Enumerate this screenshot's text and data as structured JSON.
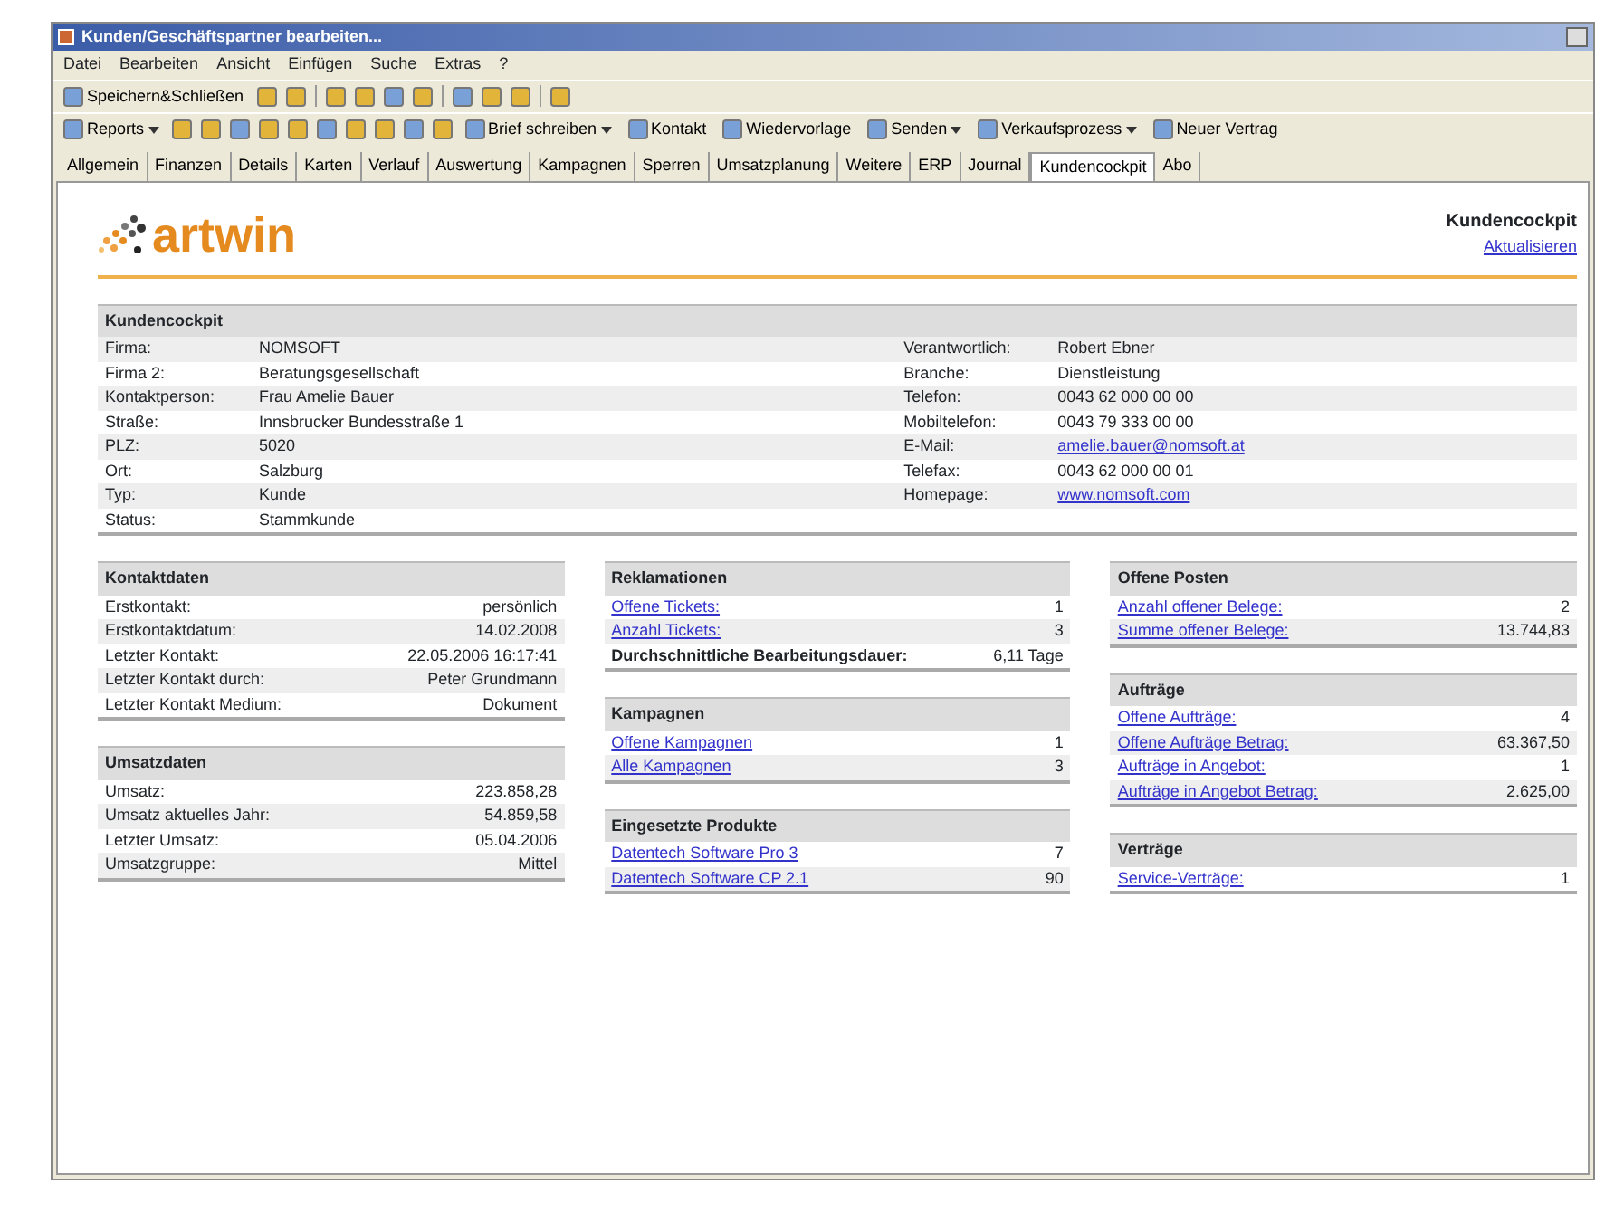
{
  "window": {
    "title": "Kunden/Geschäftspartner bearbeiten..."
  },
  "menu": [
    "Datei",
    "Bearbeiten",
    "Ansicht",
    "Einfügen",
    "Suche",
    "Extras",
    "?"
  ],
  "toolbar": [
    {
      "kind": "button",
      "label": "Speichern&Schließen"
    },
    {
      "kind": "icon"
    },
    {
      "kind": "icon"
    },
    {
      "kind": "sep"
    },
    {
      "kind": "icon"
    },
    {
      "kind": "icon"
    },
    {
      "kind": "icon"
    },
    {
      "kind": "icon"
    },
    {
      "kind": "sep"
    },
    {
      "kind": "icon"
    },
    {
      "kind": "icon"
    },
    {
      "kind": "icon"
    },
    {
      "kind": "sep"
    },
    {
      "kind": "icon"
    }
  ],
  "toolbar2": [
    {
      "kind": "dropdown",
      "label": "Reports"
    },
    {
      "kind": "icon"
    },
    {
      "kind": "icon"
    },
    {
      "kind": "icon"
    },
    {
      "kind": "icon"
    },
    {
      "kind": "icon"
    },
    {
      "kind": "icon"
    },
    {
      "kind": "icon"
    },
    {
      "kind": "icon"
    },
    {
      "kind": "icon"
    },
    {
      "kind": "icon"
    },
    {
      "kind": "dropdown",
      "label": "Brief schreiben"
    },
    {
      "kind": "button",
      "label": "Kontakt"
    },
    {
      "kind": "button",
      "label": "Wiedervorlage"
    },
    {
      "kind": "dropdown",
      "label": "Senden"
    },
    {
      "kind": "dropdown",
      "label": "Verkaufsprozess"
    },
    {
      "kind": "button",
      "label": "Neuer Vertrag"
    }
  ],
  "tabs": [
    {
      "label": "Allgemein",
      "selected": false
    },
    {
      "label": "Finanzen",
      "selected": false
    },
    {
      "label": "Details",
      "selected": false
    },
    {
      "label": "Karten",
      "selected": false
    },
    {
      "label": "Verlauf",
      "selected": false
    },
    {
      "label": "Auswertung",
      "selected": false
    },
    {
      "label": "Kampagnen",
      "selected": false
    },
    {
      "label": "Sperren",
      "selected": false
    },
    {
      "label": "Umsatzplanung",
      "selected": false
    },
    {
      "label": "Weitere",
      "selected": false
    },
    {
      "label": "ERP",
      "selected": false
    },
    {
      "label": "Journal",
      "selected": false
    },
    {
      "label": "Kundencockpit",
      "selected": true
    },
    {
      "label": "Abo",
      "selected": false
    }
  ],
  "header": {
    "logo": "artwin",
    "title": "Kundencockpit",
    "link": "Aktualisieren"
  },
  "overview": {
    "title": "Kundencockpit",
    "left": [
      {
        "label": "Firma:",
        "value": "NOMSOFT"
      },
      {
        "label": "Firma 2:",
        "value": "Beratungsgesellschaft"
      },
      {
        "label": "Kontaktperson:",
        "value": "Frau Amelie Bauer"
      },
      {
        "label": "Straße:",
        "value": "Innsbrucker Bundesstraße 1"
      },
      {
        "label": "PLZ:",
        "value": "5020"
      },
      {
        "label": "Ort:",
        "value": "Salzburg"
      },
      {
        "label": "Typ:",
        "value": "Kunde"
      },
      {
        "label": "Status:",
        "value": "Stammkunde"
      }
    ],
    "right": [
      {
        "label": "Verantwortlich:",
        "value": "Robert Ebner",
        "kind": "text"
      },
      {
        "label": "Branche:",
        "value": "Dienstleistung",
        "kind": "text"
      },
      {
        "label": "Telefon:",
        "value": "0043 62 000 00 00",
        "kind": "text"
      },
      {
        "label": "Mobiltelefon:",
        "value": "0043 79 333 00 00",
        "kind": "text"
      },
      {
        "label": "E-Mail:",
        "value": "amelie.bauer@nomsoft.at",
        "kind": "link"
      },
      {
        "label": "Telefax:",
        "value": "0043 62 000 00 01",
        "kind": "text"
      },
      {
        "label": "Homepage:",
        "value": "www.nomsoft.com",
        "kind": "link"
      }
    ]
  },
  "columns": [
    [
      {
        "title": "Kontaktdaten",
        "rows": [
          {
            "label": "Erstkontakt:",
            "value": "persönlich",
            "kind": "text"
          },
          {
            "label": "Erstkontaktdatum:",
            "value": "14.02.2008",
            "kind": "text"
          },
          {
            "label": "Letzter Kontakt:",
            "value": "22.05.2006 16:17:41",
            "kind": "text"
          },
          {
            "label": "Letzter Kontakt durch:",
            "value": "Peter Grundmann",
            "kind": "text"
          },
          {
            "label": "Letzter Kontakt Medium:",
            "value": "Dokument",
            "kind": "text"
          }
        ]
      },
      {
        "title": "Umsatzdaten",
        "rows": [
          {
            "label": "Umsatz:",
            "value": "223.858,28",
            "kind": "text"
          },
          {
            "label": "Umsatz aktuelles Jahr:",
            "value": "54.859,58",
            "kind": "text"
          },
          {
            "label": "Letzter Umsatz:",
            "value": "05.04.2006",
            "kind": "text"
          },
          {
            "label": "Umsatzgruppe:",
            "value": "Mittel",
            "kind": "text"
          }
        ]
      }
    ],
    [
      {
        "title": "Reklamationen",
        "rows": [
          {
            "label": "Offene Tickets:",
            "value": "1",
            "kind": "link"
          },
          {
            "label": "Anzahl Tickets:",
            "value": "3",
            "kind": "link"
          },
          {
            "label": "Durchschnittliche Bearbeitungsdauer:",
            "value": "6,11 Tage",
            "kind": "text"
          }
        ]
      },
      {
        "title": "Kampagnen",
        "rows": [
          {
            "label": "Offene Kampagnen",
            "value": "1",
            "kind": "link"
          },
          {
            "label": "Alle Kampagnen",
            "value": "3",
            "kind": "link"
          }
        ]
      },
      {
        "title": "Eingesetzte Produkte",
        "rows": [
          {
            "label": "Datentech Software Pro 3",
            "value": "7",
            "kind": "link"
          },
          {
            "label": "Datentech Software CP 2.1",
            "value": "90",
            "kind": "link"
          }
        ]
      }
    ],
    [
      {
        "title": "Offene Posten",
        "rows": [
          {
            "label": "Anzahl offener Belege:",
            "value": "2",
            "kind": "link"
          },
          {
            "label": "Summe offener Belege:",
            "value": "13.744,83",
            "kind": "link"
          }
        ]
      },
      {
        "title": "Aufträge",
        "rows": [
          {
            "label": "Offene Aufträge:",
            "value": "4",
            "kind": "link"
          },
          {
            "label": "Offene Aufträge Betrag:",
            "value": "63.367,50",
            "kind": "link"
          },
          {
            "label": "Aufträge in Angebot:",
            "value": "1",
            "kind": "link"
          },
          {
            "label": "Aufträge in Angebot Betrag:",
            "value": "2.625,00",
            "kind": "link"
          }
        ]
      },
      {
        "title": "Verträge",
        "rows": [
          {
            "label": "Service-Verträge:",
            "value": "1",
            "kind": "link"
          }
        ]
      }
    ]
  ]
}
